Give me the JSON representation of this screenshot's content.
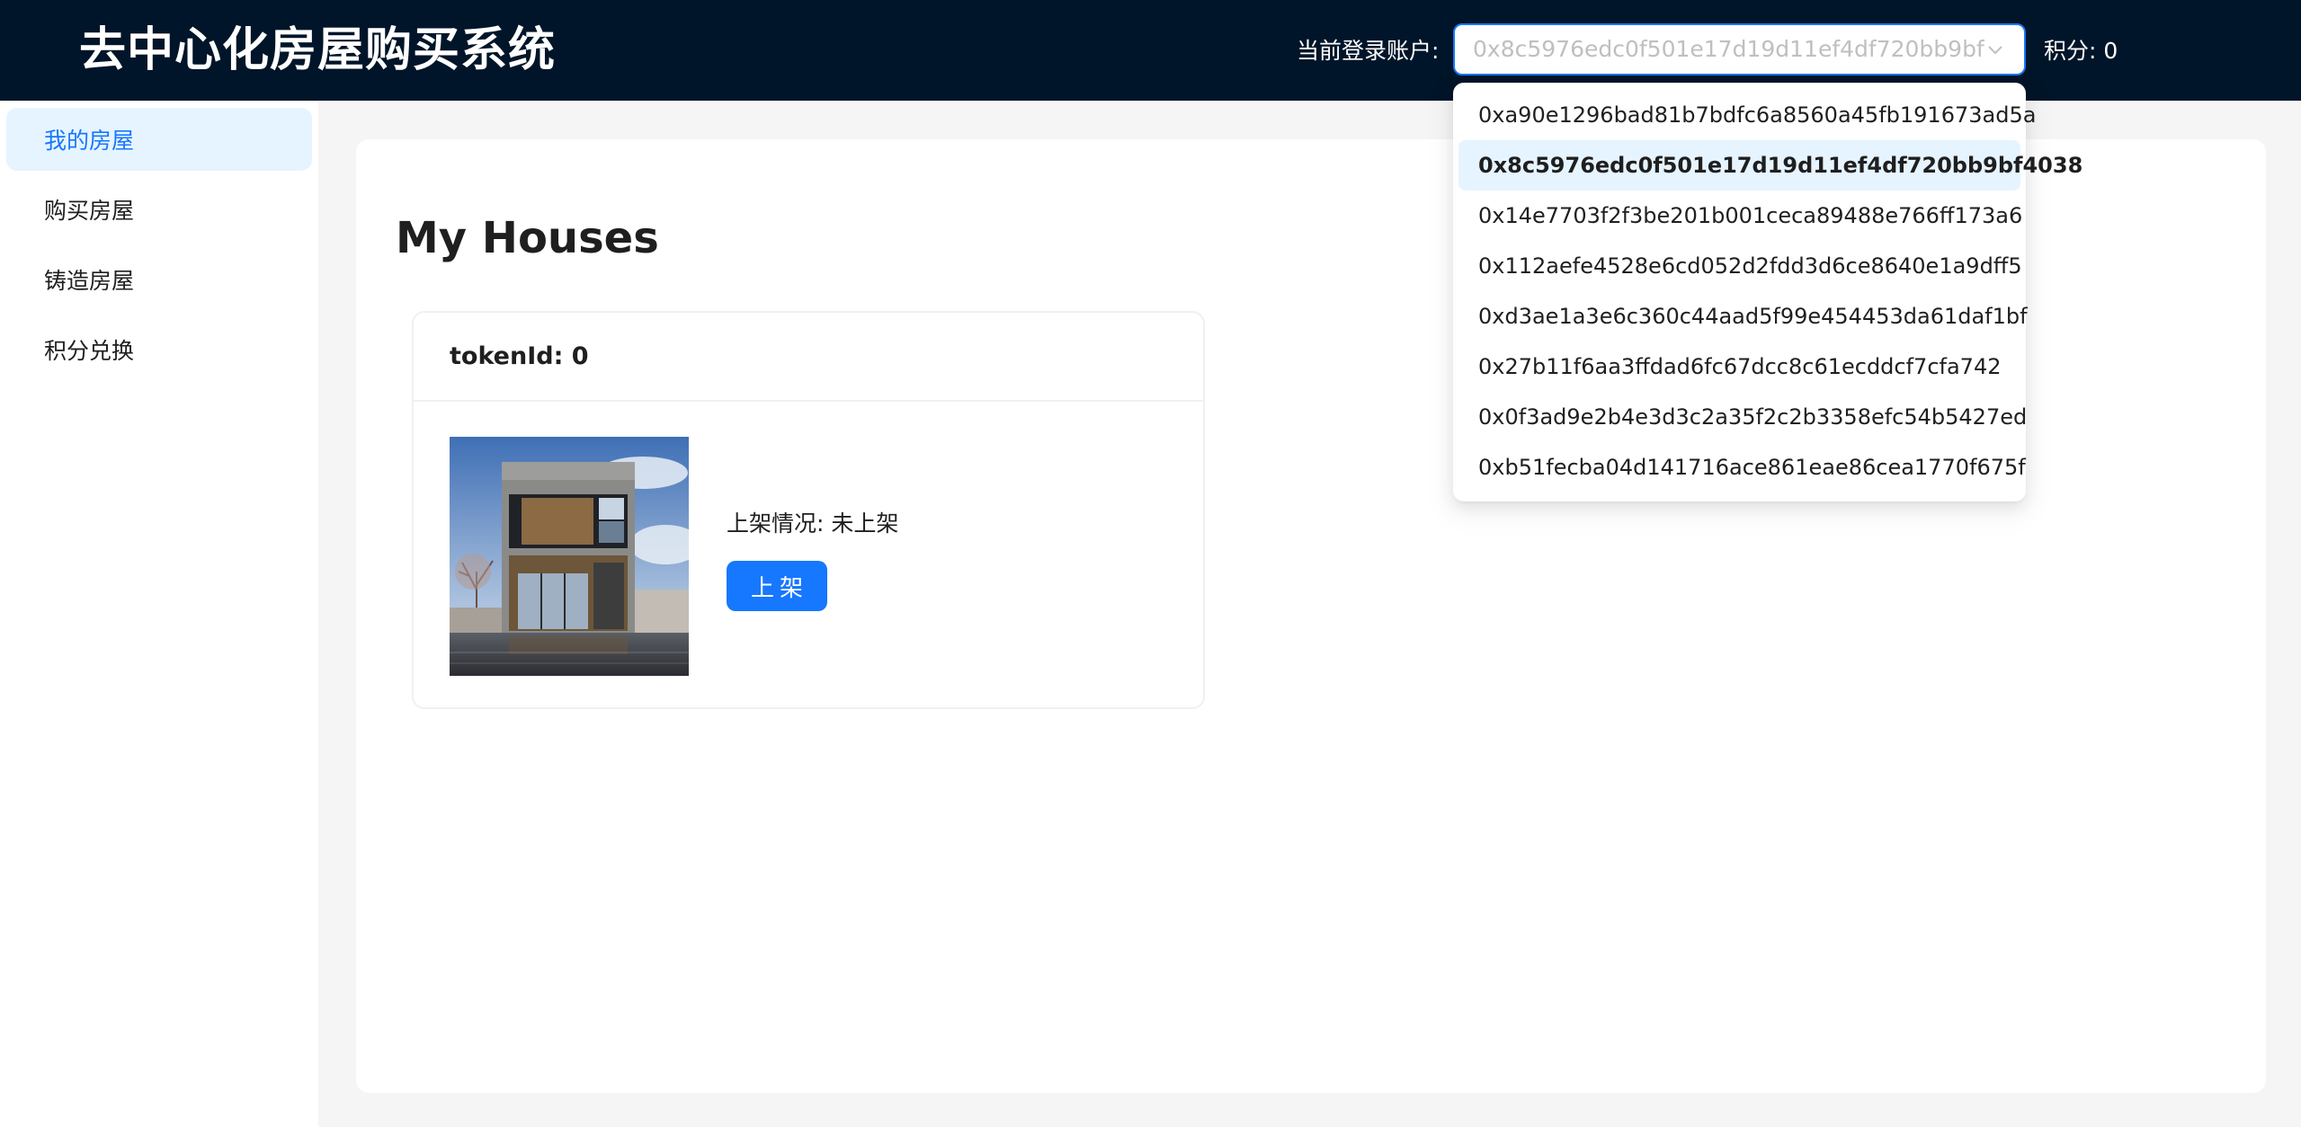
{
  "header": {
    "title": "去中心化房屋购买系统",
    "account_label": "当前登录账户:",
    "account_selected": "0x8c5976edc0f501e17d19d11ef4df720bb9bf4038",
    "points_text": "积分: 0"
  },
  "account_dropdown": {
    "options": [
      "0xa90e1296bad81b7bdfc6a8560a45fb191673ad5a",
      "0x8c5976edc0f501e17d19d11ef4df720bb9bf4038",
      "0x14e7703f2f3be201b001ceca89488e766ff173a6",
      "0x112aefe4528e6cd052d2fdd3d6ce8640e1a9dff5",
      "0xd3ae1a3e6c360c44aad5f99e454453da61daf1bf",
      "0x27b11f6aa3ffdad6fc67dcc8c61ecddcf7cfa742",
      "0x0f3ad9e2b4e3d3c2a35f2c2b3358efc54b5427ed",
      "0xb51fecba04d141716ace861eae86cea1770f675f"
    ],
    "selected_index": 1
  },
  "sidebar": {
    "items": [
      {
        "label": "我的房屋",
        "active": true
      },
      {
        "label": "购买房屋",
        "active": false
      },
      {
        "label": "铸造房屋",
        "active": false
      },
      {
        "label": "积分兑换",
        "active": false
      }
    ]
  },
  "main": {
    "heading": "My Houses",
    "house_card": {
      "token_label": "tokenId: 0",
      "status_text": "上架情况: 未上架",
      "list_button_label": "上架"
    }
  },
  "colors": {
    "header_bg": "#001529",
    "accent": "#1677ff",
    "selected_bg": "#e6f4ff"
  },
  "icons": {
    "select_arrow": "chevron-down-icon"
  }
}
